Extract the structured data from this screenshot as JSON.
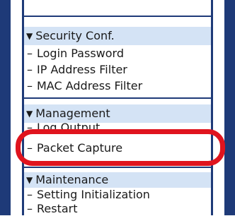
{
  "sections": [
    {
      "title": "Security Conf.",
      "items": [
        "Login Password",
        "IP Address Filter",
        "MAC Address Filter"
      ]
    },
    {
      "title": "Management",
      "items": [
        "Log Output",
        "Packet Capture"
      ]
    },
    {
      "title": "Maintenance",
      "items": [
        "Setting Initialization",
        "Restart"
      ]
    }
  ],
  "icons": {
    "section_toggle": "triangle-down-icon",
    "item_bullet": "dash-icon"
  },
  "colors": {
    "frame": "#1e3a78",
    "section_header_bg": "#d4e3f5",
    "highlight": "#e0141e"
  },
  "highlighted_item": "Packet Capture"
}
